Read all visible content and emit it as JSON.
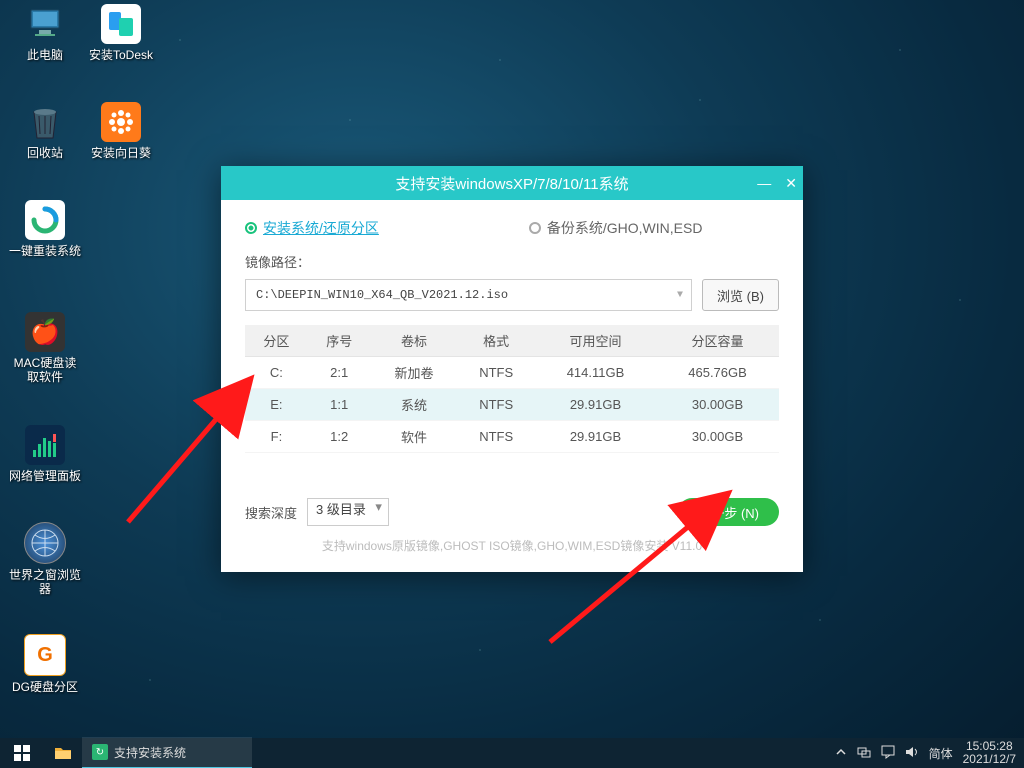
{
  "desktop_icons": {
    "pc": "此电脑",
    "todesk": "安装ToDesk",
    "bin": "回收站",
    "sunflower": "安装向日葵",
    "reinstall": "一键重装系统",
    "machd": "MAC硬盘读取软件",
    "netpanel": "网络管理面板",
    "world": "世界之窗浏览器",
    "dg": "DG硬盘分区"
  },
  "dialog": {
    "title": "支持安装windowsXP/7/8/10/11系统",
    "radio_install": "安装系统/还原分区",
    "radio_backup": "备份系统/GHO,WIN,ESD",
    "path_label": "镜像路径：",
    "path_value": "C:\\DEEPIN_WIN10_X64_QB_V2021.12.iso",
    "browse": "浏览 (B)",
    "headers": [
      "分区",
      "序号",
      "卷标",
      "格式",
      "可用空间",
      "分区容量"
    ],
    "rows": [
      {
        "drive": "C:",
        "idx": "2:1",
        "label": "新加卷",
        "fs": "NTFS",
        "free": "414.11GB",
        "size": "465.76GB",
        "selected": false
      },
      {
        "drive": "E:",
        "idx": "1:1",
        "label": "系统",
        "fs": "NTFS",
        "free": "29.91GB",
        "size": "30.00GB",
        "selected": true
      },
      {
        "drive": "F:",
        "idx": "1:2",
        "label": "软件",
        "fs": "NTFS",
        "free": "29.91GB",
        "size": "30.00GB",
        "selected": false
      }
    ],
    "search_depth_label": "搜索深度",
    "search_depth_value": "3 级目录",
    "next": "下一步 (N)",
    "support": "支持windows原版镜像,GHOST ISO镜像,GHO,WIM,ESD镜像安装 V11.0"
  },
  "taskbar": {
    "task_label": "支持安装系统",
    "ime": "简体",
    "time": "15:05:28",
    "date": "2021/12/7"
  }
}
